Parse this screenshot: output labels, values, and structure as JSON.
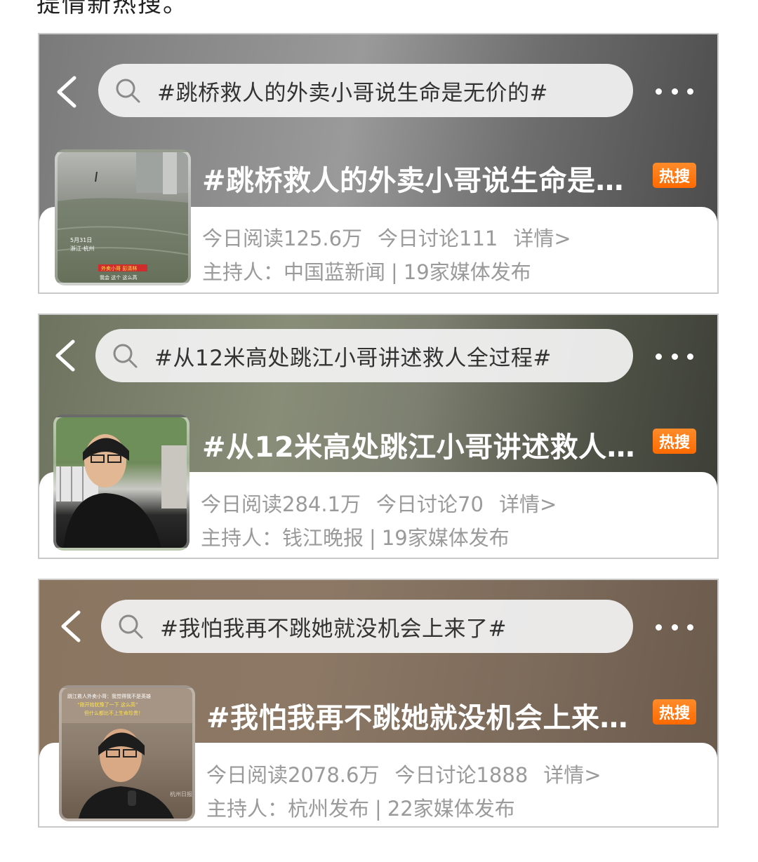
{
  "cards": [
    {
      "search_text": "#跳桥救人的外卖小哥说生命是无价的#",
      "title": "#跳桥救人的外卖小哥说生命是…",
      "badge": "热搜",
      "reads": "今日阅读125.6万",
      "discussions": "今日讨论111",
      "details": "详情>",
      "host_label": "主持人：",
      "host": "中国蓝新闻",
      "separator": "|",
      "media": "19家媒体发布",
      "thumb_caption_line1": "外卖小哥 彭清林",
      "thumb_caption_line2": "我会 这个 这么高",
      "thumb_date": "5月31日",
      "thumb_place": "浙江·杭州"
    },
    {
      "search_text": "#从12米高处跳江小哥讲述救人全过程#",
      "title": "#从12米高处跳江小哥讲述救人…",
      "badge": "热搜",
      "reads": "今日阅读284.1万",
      "discussions": "今日讨论70",
      "details": "详情>",
      "host_label": "主持人：",
      "host": "钱江晚报",
      "separator": "|",
      "media": "19家媒体发布"
    },
    {
      "search_text": "#我怕我再不跳她就没机会上来了#",
      "title": "#我怕我再不跳她就没机会上来…",
      "badge": "热搜",
      "reads": "今日阅读2078.6万",
      "discussions": "今日讨论1888",
      "details": "详情>",
      "host_label": "主持人：",
      "host": "杭州发布",
      "separator": "|",
      "media": "22家媒体发布",
      "thumb_caption_line1": "跳江救人外卖小哥：我觉得我不是英雄",
      "thumb_caption_line2": "“刚开始犹豫了一下 这么高”",
      "thumb_caption_line3": "但什么都比不上生命珍贵！",
      "thumb_watermark": "杭州日报"
    }
  ],
  "colors": {
    "badge": "#ff7a10",
    "muted_text": "#9a9a9a"
  }
}
